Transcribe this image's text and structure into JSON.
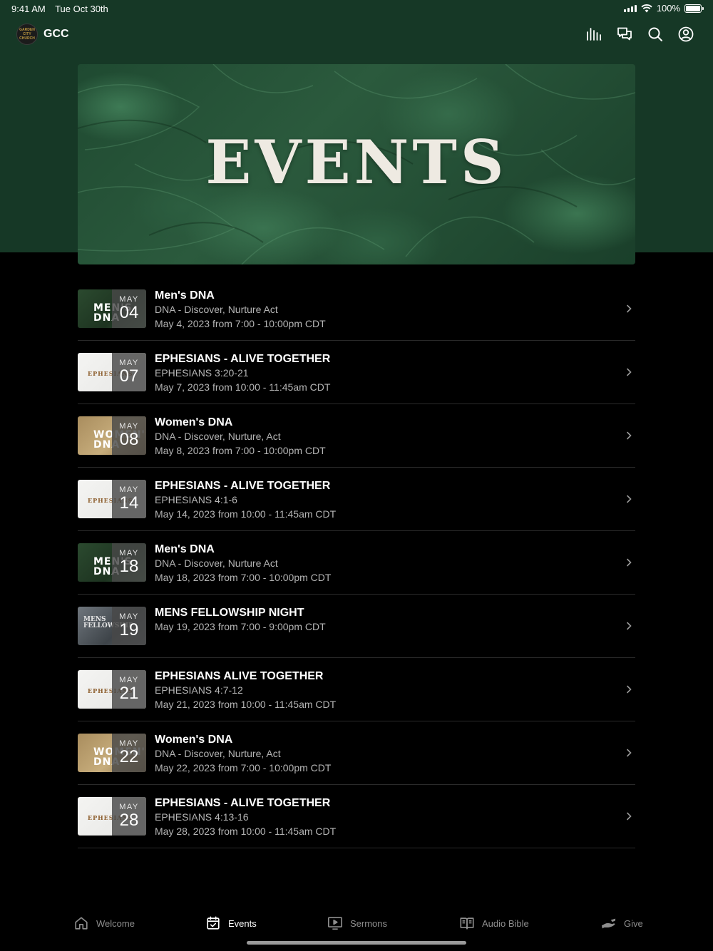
{
  "status_bar": {
    "time": "9:41 AM",
    "date": "Tue Oct 30th",
    "battery": "100%"
  },
  "header": {
    "app_title": "GCC",
    "logo_text": "GARDEN CITY CHURCH",
    "icons": [
      "audio-bars-icon",
      "chat-icon",
      "search-icon",
      "account-icon"
    ]
  },
  "hero": {
    "title": "EVENTS"
  },
  "events": [
    {
      "month": "MAY",
      "day": "04",
      "title": "Men's DNA",
      "subtitle": "DNA - Discover, Nurture Act",
      "when": "May 4, 2023 from 7:00 - 10:00pm CDT",
      "thumb_text": "MEN'S DNA"
    },
    {
      "month": "MAY",
      "day": "07",
      "title": "EPHESIANS - ALIVE TOGETHER",
      "subtitle": "EPHESIANS 3:20-21",
      "when": "May 7, 2023 from 10:00 - 11:45am CDT",
      "thumb_text": "EPHESIANS"
    },
    {
      "month": "MAY",
      "day": "08",
      "title": "Women's DNA",
      "subtitle": "DNA - Discover, Nurture, Act",
      "when": "May 8, 2023 from 7:00 - 10:00pm CDT",
      "thumb_text": "WOMEN'S DNA"
    },
    {
      "month": "MAY",
      "day": "14",
      "title": "EPHESIANS - ALIVE TOGETHER",
      "subtitle": "EPHESIANS 4:1-6",
      "when": "May 14, 2023 from 10:00 - 11:45am CDT",
      "thumb_text": "EPHESIANS"
    },
    {
      "month": "MAY",
      "day": "18",
      "title": "Men's DNA",
      "subtitle": "DNA - Discover, Nurture Act",
      "when": "May 18, 2023 from 7:00 - 10:00pm CDT",
      "thumb_text": "MEN'S DNA"
    },
    {
      "month": "MAY",
      "day": "19",
      "title": "MENS FELLOWSHIP NIGHT",
      "subtitle": "",
      "when": "May 19, 2023 from 7:00 - 9:00pm CDT",
      "thumb_text": "MENS FELLOWSHIP"
    },
    {
      "month": "MAY",
      "day": "21",
      "title": "EPHESIANS ALIVE TOGETHER",
      "subtitle": "EPHESIANS 4:7-12",
      "when": "May 21, 2023 from 10:00 - 11:45am CDT",
      "thumb_text": "EPHESIANS"
    },
    {
      "month": "MAY",
      "day": "22",
      "title": "Women's DNA",
      "subtitle": "DNA - Discover, Nurture, Act",
      "when": "May 22, 2023 from 7:00 - 10:00pm CDT",
      "thumb_text": "WOMEN'S DNA"
    },
    {
      "month": "MAY",
      "day": "28",
      "title": "EPHESIANS - ALIVE TOGETHER",
      "subtitle": "EPHESIANS 4:13-16",
      "when": "May 28, 2023 from 10:00 - 11:45am CDT",
      "thumb_text": "EPHESIANS"
    }
  ],
  "tabs": [
    {
      "label": "Welcome",
      "icon": "home-icon",
      "active": false
    },
    {
      "label": "Events",
      "icon": "calendar-icon",
      "active": true
    },
    {
      "label": "Sermons",
      "icon": "tv-play-icon",
      "active": false
    },
    {
      "label": "Audio Bible",
      "icon": "book-icon",
      "active": false
    },
    {
      "label": "Give",
      "icon": "hand-give-icon",
      "active": false
    }
  ],
  "colors": {
    "header_green": "#163826",
    "background": "#000000",
    "divider": "#2a2a2a",
    "inactive_tab": "#8e8e8e"
  }
}
